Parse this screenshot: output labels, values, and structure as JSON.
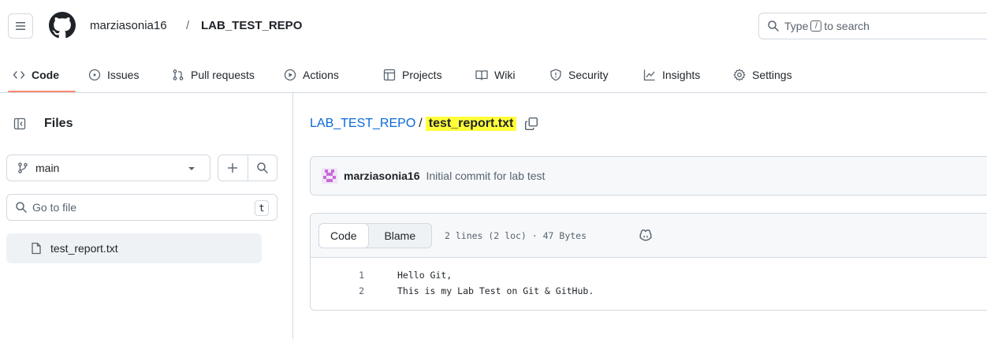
{
  "header": {
    "owner": "marziasonia16",
    "slash": "/",
    "repo": "LAB_TEST_REPO",
    "search_prefix": "Type",
    "search_key": "/",
    "search_suffix": "to search"
  },
  "nav": {
    "code": "Code",
    "issues": "Issues",
    "pull_requests": "Pull requests",
    "actions": "Actions",
    "projects": "Projects",
    "wiki": "Wiki",
    "security": "Security",
    "insights": "Insights",
    "settings": "Settings"
  },
  "sidebar": {
    "title": "Files",
    "branch": "main",
    "goto_placeholder": "Go to file",
    "goto_key": "t",
    "files": [
      {
        "name": "test_report.txt"
      }
    ]
  },
  "main": {
    "path_repo": "LAB_TEST_REPO",
    "path_sep": "/",
    "path_file": "test_report.txt",
    "commit_author": "marziasonia16",
    "commit_message": "Initial commit for lab test",
    "tab_code": "Code",
    "tab_blame": "Blame",
    "meta": "2 lines (2 loc) · 47 Bytes",
    "lines": [
      {
        "num": "1",
        "text": "Hello Git,"
      },
      {
        "num": "2",
        "text": "This is my Lab Test on Git & GitHub."
      }
    ]
  },
  "colors": {
    "link": "#0969da",
    "highlight": "#ffff3a",
    "active_tab_underline": "#fd8c73",
    "border": "#d1d9e0"
  }
}
